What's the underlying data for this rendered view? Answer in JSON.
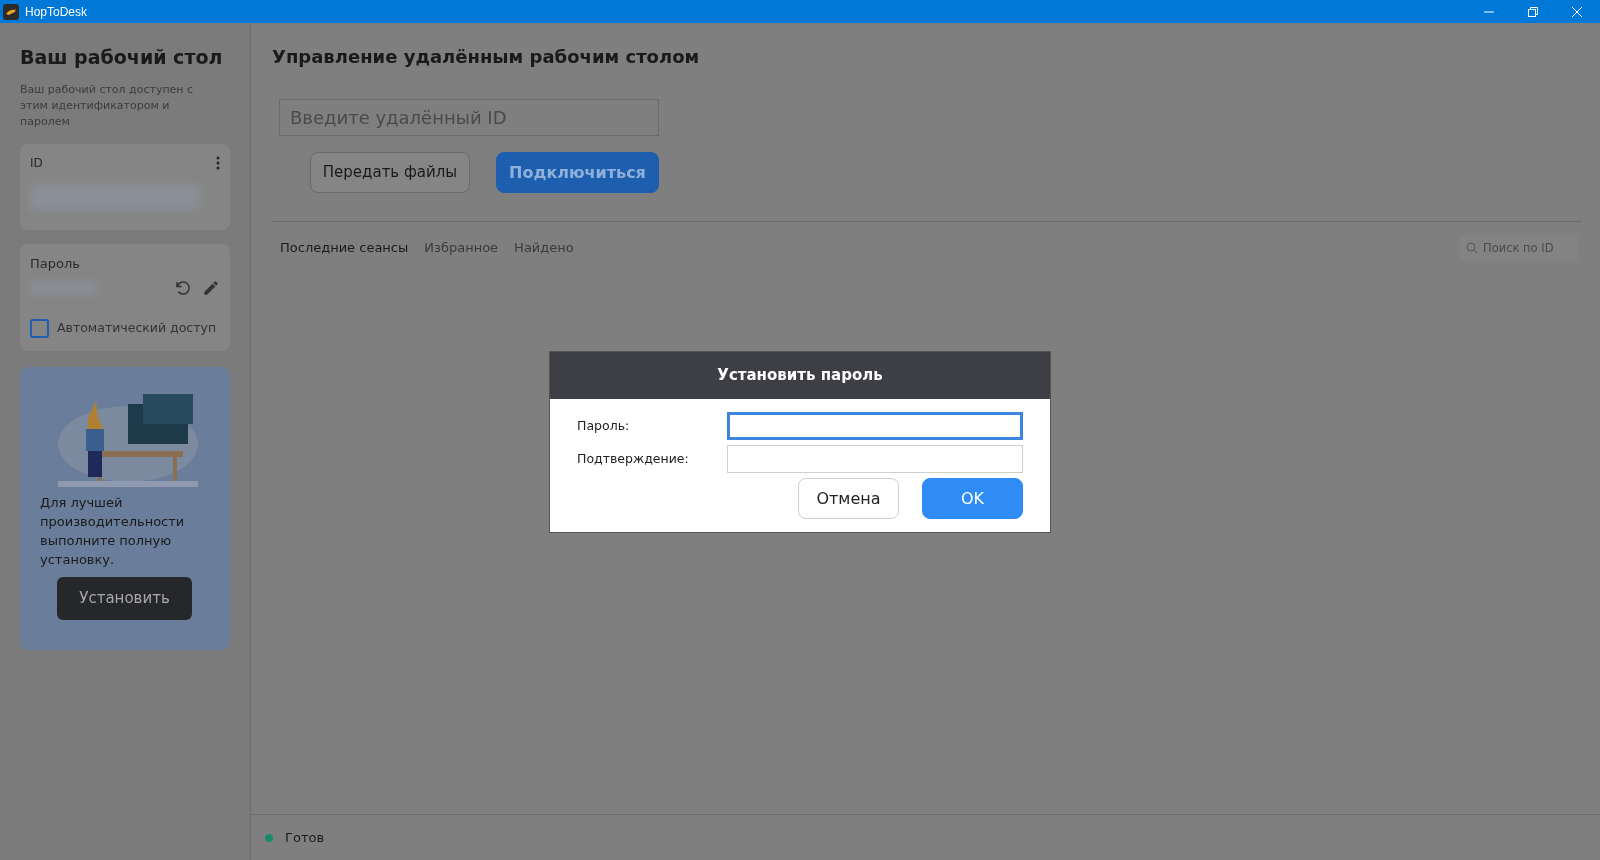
{
  "window": {
    "title": "HopToDesk"
  },
  "sidebar": {
    "title": "Ваш рабочий стол",
    "description": "Ваш рабочий стол доступен с этим идентификатором и паролем",
    "id_card": {
      "label": "ID"
    },
    "password_card": {
      "label": "Пароль",
      "auto_access": {
        "label": "Автоматический доступ",
        "checked": false
      }
    },
    "promo": {
      "text": "Для лучшей производительности выполните полную установку.",
      "button": "Установить"
    }
  },
  "main": {
    "title": "Управление удалённым рабочим столом",
    "remote_id": {
      "placeholder": "Введите удалённый ID"
    },
    "buttons": [
      {
        "label": "Передать файлы",
        "kind": "secondary"
      },
      {
        "label": "Подключиться",
        "kind": "primary"
      }
    ],
    "tabs": [
      {
        "label": "Последние сеансы",
        "selected": true
      },
      {
        "label": "Избранное",
        "selected": false
      },
      {
        "label": "Найдено",
        "selected": false
      }
    ],
    "search": {
      "placeholder": "Поиск по ID"
    }
  },
  "status_bar": {
    "text": "Готов"
  },
  "dialog": {
    "title": "Установить пароль",
    "fields": [
      {
        "label": "Пароль:",
        "focused": true
      },
      {
        "label": "Подтверждение:",
        "focused": false
      }
    ],
    "buttons": [
      {
        "label": "Отмена",
        "kind": "secondary"
      },
      {
        "label": "OK",
        "kind": "primary"
      }
    ]
  }
}
